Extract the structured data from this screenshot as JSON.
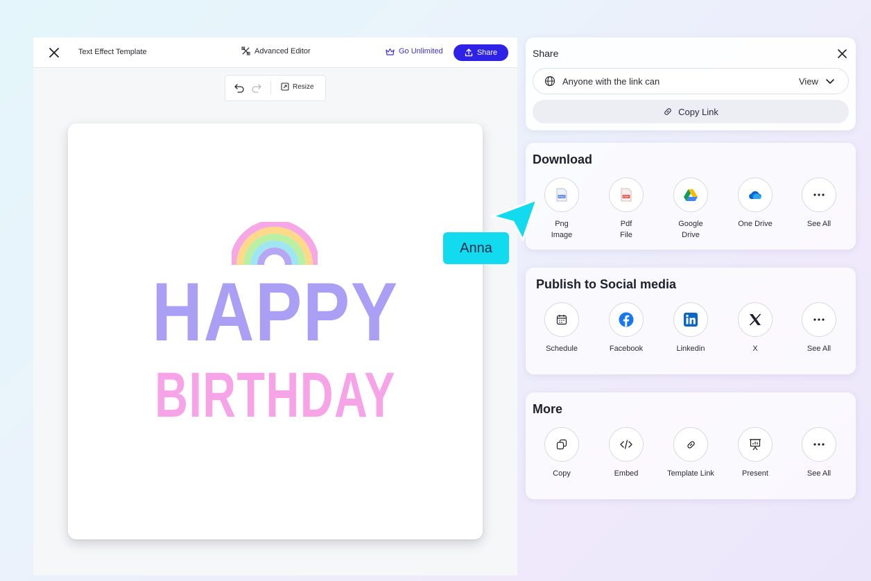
{
  "editor": {
    "title": "Text Effect Template",
    "advanced_editor": "Advanced Editor",
    "go_unlimited": "Go Unlimited",
    "share": "Share",
    "resize": "Resize",
    "accent": "#2e22e6"
  },
  "canvas": {
    "line1": "HAPPY",
    "line2": "BIRTHDAY",
    "line1_color": "#ab9ff5",
    "line2_color": "#f7a3e8"
  },
  "share": {
    "title": "Share",
    "link_access": "Anyone with the link can",
    "permission": "View",
    "copy_link": "Copy Link"
  },
  "download": {
    "title": "Download",
    "items": [
      {
        "label": "Png\nImage",
        "icon": "png-file-icon"
      },
      {
        "label": "Pdf\nFile",
        "icon": "pdf-file-icon"
      },
      {
        "label": "Google\nDrive",
        "icon": "google-drive-icon"
      },
      {
        "label": "One Drive",
        "icon": "onedrive-icon"
      },
      {
        "label": "See All",
        "icon": "more-icon"
      }
    ]
  },
  "social": {
    "title": "Publish to Social media",
    "items": [
      {
        "label": "Schedule",
        "icon": "calendar-icon"
      },
      {
        "label": "Facebook",
        "icon": "facebook-icon"
      },
      {
        "label": "Linkedin",
        "icon": "linkedin-icon"
      },
      {
        "label": "X",
        "icon": "x-icon"
      },
      {
        "label": "See All",
        "icon": "more-icon"
      }
    ]
  },
  "more": {
    "title": "More",
    "items": [
      {
        "label": "Copy",
        "icon": "copy-icon"
      },
      {
        "label": "Embed",
        "icon": "embed-icon"
      },
      {
        "label": "Template Link",
        "icon": "link-icon"
      },
      {
        "label": "Present",
        "icon": "present-icon"
      },
      {
        "label": "See All",
        "icon": "more-icon"
      }
    ]
  },
  "cursor": {
    "name": "Anna",
    "color": "#12dbef"
  }
}
